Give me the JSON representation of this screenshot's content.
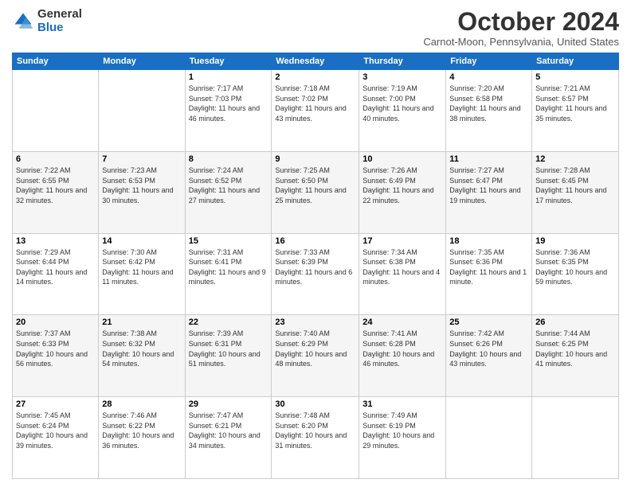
{
  "logo": {
    "general": "General",
    "blue": "Blue"
  },
  "header": {
    "month": "October 2024",
    "location": "Carnot-Moon, Pennsylvania, United States"
  },
  "days_of_week": [
    "Sunday",
    "Monday",
    "Tuesday",
    "Wednesday",
    "Thursday",
    "Friday",
    "Saturday"
  ],
  "weeks": [
    [
      {
        "day": "",
        "info": ""
      },
      {
        "day": "",
        "info": ""
      },
      {
        "day": "1",
        "info": "Sunrise: 7:17 AM\nSunset: 7:03 PM\nDaylight: 11 hours and 46 minutes."
      },
      {
        "day": "2",
        "info": "Sunrise: 7:18 AM\nSunset: 7:02 PM\nDaylight: 11 hours and 43 minutes."
      },
      {
        "day": "3",
        "info": "Sunrise: 7:19 AM\nSunset: 7:00 PM\nDaylight: 11 hours and 40 minutes."
      },
      {
        "day": "4",
        "info": "Sunrise: 7:20 AM\nSunset: 6:58 PM\nDaylight: 11 hours and 38 minutes."
      },
      {
        "day": "5",
        "info": "Sunrise: 7:21 AM\nSunset: 6:57 PM\nDaylight: 11 hours and 35 minutes."
      }
    ],
    [
      {
        "day": "6",
        "info": "Sunrise: 7:22 AM\nSunset: 6:55 PM\nDaylight: 11 hours and 32 minutes."
      },
      {
        "day": "7",
        "info": "Sunrise: 7:23 AM\nSunset: 6:53 PM\nDaylight: 11 hours and 30 minutes."
      },
      {
        "day": "8",
        "info": "Sunrise: 7:24 AM\nSunset: 6:52 PM\nDaylight: 11 hours and 27 minutes."
      },
      {
        "day": "9",
        "info": "Sunrise: 7:25 AM\nSunset: 6:50 PM\nDaylight: 11 hours and 25 minutes."
      },
      {
        "day": "10",
        "info": "Sunrise: 7:26 AM\nSunset: 6:49 PM\nDaylight: 11 hours and 22 minutes."
      },
      {
        "day": "11",
        "info": "Sunrise: 7:27 AM\nSunset: 6:47 PM\nDaylight: 11 hours and 19 minutes."
      },
      {
        "day": "12",
        "info": "Sunrise: 7:28 AM\nSunset: 6:45 PM\nDaylight: 11 hours and 17 minutes."
      }
    ],
    [
      {
        "day": "13",
        "info": "Sunrise: 7:29 AM\nSunset: 6:44 PM\nDaylight: 11 hours and 14 minutes."
      },
      {
        "day": "14",
        "info": "Sunrise: 7:30 AM\nSunset: 6:42 PM\nDaylight: 11 hours and 11 minutes."
      },
      {
        "day": "15",
        "info": "Sunrise: 7:31 AM\nSunset: 6:41 PM\nDaylight: 11 hours and 9 minutes."
      },
      {
        "day": "16",
        "info": "Sunrise: 7:33 AM\nSunset: 6:39 PM\nDaylight: 11 hours and 6 minutes."
      },
      {
        "day": "17",
        "info": "Sunrise: 7:34 AM\nSunset: 6:38 PM\nDaylight: 11 hours and 4 minutes."
      },
      {
        "day": "18",
        "info": "Sunrise: 7:35 AM\nSunset: 6:36 PM\nDaylight: 11 hours and 1 minute."
      },
      {
        "day": "19",
        "info": "Sunrise: 7:36 AM\nSunset: 6:35 PM\nDaylight: 10 hours and 59 minutes."
      }
    ],
    [
      {
        "day": "20",
        "info": "Sunrise: 7:37 AM\nSunset: 6:33 PM\nDaylight: 10 hours and 56 minutes."
      },
      {
        "day": "21",
        "info": "Sunrise: 7:38 AM\nSunset: 6:32 PM\nDaylight: 10 hours and 54 minutes."
      },
      {
        "day": "22",
        "info": "Sunrise: 7:39 AM\nSunset: 6:31 PM\nDaylight: 10 hours and 51 minutes."
      },
      {
        "day": "23",
        "info": "Sunrise: 7:40 AM\nSunset: 6:29 PM\nDaylight: 10 hours and 48 minutes."
      },
      {
        "day": "24",
        "info": "Sunrise: 7:41 AM\nSunset: 6:28 PM\nDaylight: 10 hours and 46 minutes."
      },
      {
        "day": "25",
        "info": "Sunrise: 7:42 AM\nSunset: 6:26 PM\nDaylight: 10 hours and 43 minutes."
      },
      {
        "day": "26",
        "info": "Sunrise: 7:44 AM\nSunset: 6:25 PM\nDaylight: 10 hours and 41 minutes."
      }
    ],
    [
      {
        "day": "27",
        "info": "Sunrise: 7:45 AM\nSunset: 6:24 PM\nDaylight: 10 hours and 39 minutes."
      },
      {
        "day": "28",
        "info": "Sunrise: 7:46 AM\nSunset: 6:22 PM\nDaylight: 10 hours and 36 minutes."
      },
      {
        "day": "29",
        "info": "Sunrise: 7:47 AM\nSunset: 6:21 PM\nDaylight: 10 hours and 34 minutes."
      },
      {
        "day": "30",
        "info": "Sunrise: 7:48 AM\nSunset: 6:20 PM\nDaylight: 10 hours and 31 minutes."
      },
      {
        "day": "31",
        "info": "Sunrise: 7:49 AM\nSunset: 6:19 PM\nDaylight: 10 hours and 29 minutes."
      },
      {
        "day": "",
        "info": ""
      },
      {
        "day": "",
        "info": ""
      }
    ]
  ]
}
